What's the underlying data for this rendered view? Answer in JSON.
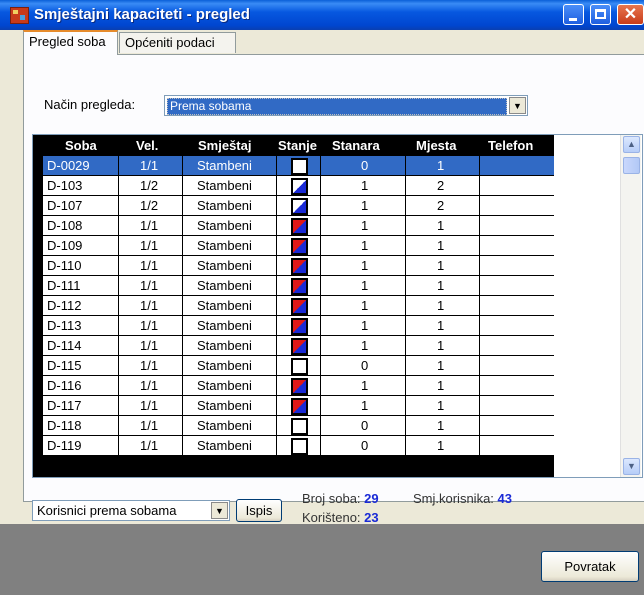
{
  "window": {
    "title": "Smještajni kapaciteti - pregled"
  },
  "tabs": [
    {
      "label": "Pregled soba",
      "active": true
    },
    {
      "label": "Općeniti podaci",
      "active": false
    }
  ],
  "view_mode": {
    "label": "Način pregleda:",
    "value": "Prema sobama"
  },
  "table": {
    "headers": {
      "soba": "Soba",
      "vel": "Vel.",
      "smjestaj": "Smještaj",
      "stanje": "Stanje",
      "stanara": "Stanara",
      "mjesta": "Mjesta",
      "telefon": "Telefon"
    },
    "rows": [
      {
        "soba": "D-0029",
        "vel": "1/1",
        "smjestaj": "Stambeni",
        "stanje": "empty",
        "stanara": "0",
        "mjesta": "1",
        "telefon": "",
        "selected": true
      },
      {
        "soba": "D-103",
        "vel": "1/2",
        "smjestaj": "Stambeni",
        "stanje": "partial",
        "stanara": "1",
        "mjesta": "2",
        "telefon": ""
      },
      {
        "soba": "D-107",
        "vel": "1/2",
        "smjestaj": "Stambeni",
        "stanje": "partial",
        "stanara": "1",
        "mjesta": "2",
        "telefon": ""
      },
      {
        "soba": "D-108",
        "vel": "1/1",
        "smjestaj": "Stambeni",
        "stanje": "full",
        "stanara": "1",
        "mjesta": "1",
        "telefon": ""
      },
      {
        "soba": "D-109",
        "vel": "1/1",
        "smjestaj": "Stambeni",
        "stanje": "full",
        "stanara": "1",
        "mjesta": "1",
        "telefon": ""
      },
      {
        "soba": "D-110",
        "vel": "1/1",
        "smjestaj": "Stambeni",
        "stanje": "full",
        "stanara": "1",
        "mjesta": "1",
        "telefon": ""
      },
      {
        "soba": "D-111",
        "vel": "1/1",
        "smjestaj": "Stambeni",
        "stanje": "full",
        "stanara": "1",
        "mjesta": "1",
        "telefon": ""
      },
      {
        "soba": "D-112",
        "vel": "1/1",
        "smjestaj": "Stambeni",
        "stanje": "full",
        "stanara": "1",
        "mjesta": "1",
        "telefon": ""
      },
      {
        "soba": "D-113",
        "vel": "1/1",
        "smjestaj": "Stambeni",
        "stanje": "full",
        "stanara": "1",
        "mjesta": "1",
        "telefon": ""
      },
      {
        "soba": "D-114",
        "vel": "1/1",
        "smjestaj": "Stambeni",
        "stanje": "full",
        "stanara": "1",
        "mjesta": "1",
        "telefon": ""
      },
      {
        "soba": "D-115",
        "vel": "1/1",
        "smjestaj": "Stambeni",
        "stanje": "empty",
        "stanara": "0",
        "mjesta": "1",
        "telefon": ""
      },
      {
        "soba": "D-116",
        "vel": "1/1",
        "smjestaj": "Stambeni",
        "stanje": "full",
        "stanara": "1",
        "mjesta": "1",
        "telefon": ""
      },
      {
        "soba": "D-117",
        "vel": "1/1",
        "smjestaj": "Stambeni",
        "stanje": "full",
        "stanara": "1",
        "mjesta": "1",
        "telefon": ""
      },
      {
        "soba": "D-118",
        "vel": "1/1",
        "smjestaj": "Stambeni",
        "stanje": "empty",
        "stanara": "0",
        "mjesta": "1",
        "telefon": ""
      },
      {
        "soba": "D-119",
        "vel": "1/1",
        "smjestaj": "Stambeni",
        "stanje": "empty",
        "stanara": "0",
        "mjesta": "1",
        "telefon": ""
      }
    ]
  },
  "report": {
    "value": "Korisnici prema sobama",
    "print_label": "Ispis"
  },
  "stats": {
    "broj_soba_label": "Broj soba:",
    "broj_soba": "29",
    "koristeno_label": "Korišteno:",
    "koristeno": "23",
    "smj_label": "Smj.korisnika:",
    "smj": "43"
  },
  "footer": {
    "back_label": "Povratak"
  },
  "colors": {
    "title_bar": "#0058e6",
    "selection": "#316ac5",
    "stat_value": "#1a2ad6",
    "status_red": "#e01818",
    "status_blue": "#1a2ad6"
  }
}
